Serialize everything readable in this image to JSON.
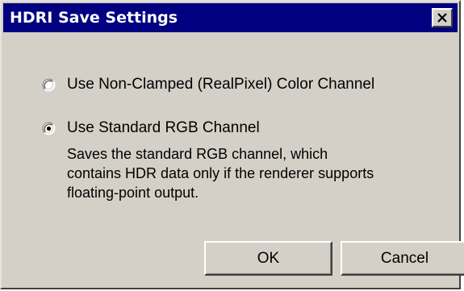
{
  "dialog": {
    "title": "HDRI Save Settings",
    "close_icon": "close-icon"
  },
  "options": [
    {
      "label": "Use Non-Clamped (RealPixel) Color Channel",
      "selected": false
    },
    {
      "label": "Use Standard RGB Channel",
      "selected": true
    }
  ],
  "description": {
    "lines": [
      "Saves the standard RGB channel, which",
      "contains HDR data only if the renderer supports",
      "floating-point output."
    ]
  },
  "buttons": {
    "ok": "OK",
    "cancel": "Cancel"
  }
}
